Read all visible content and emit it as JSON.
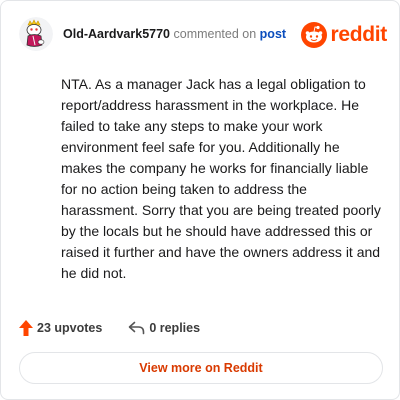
{
  "header": {
    "username": "Old-Aardvark5770",
    "action_text": "commented on",
    "post_link": "post",
    "logo_text": "reddit"
  },
  "comment": {
    "text": "NTA. As a manager Jack has a legal obligation to report/address harassment in the workplace. He failed to take any steps to make your work environment feel safe for you. Additionally he makes the company he works for financially liable for no action being taken to address the harassment. Sorry that you are being treated poorly by the locals but he should have addressed this or raised it further and have the owners address it and he did not."
  },
  "footer": {
    "upvotes": "23 upvotes",
    "replies": "0 replies",
    "view_more": "View more on Reddit"
  },
  "icons": {
    "avatar": "snoo-avatar-icon",
    "logo": "reddit-logo-icon",
    "upvote": "upvote-arrow-icon",
    "reply": "reply-arrow-icon"
  },
  "colors": {
    "brand": "#ff4500",
    "link": "#0a4dbd",
    "button_text": "#d93a00",
    "border": "#e3e5e8"
  }
}
